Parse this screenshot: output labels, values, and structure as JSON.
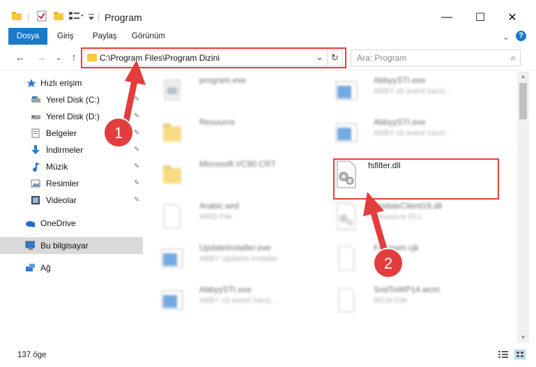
{
  "window": {
    "title": "Program",
    "minimize": "—",
    "maximize": "☐",
    "close": "✕"
  },
  "ribbon": {
    "tabs": [
      "Dosya",
      "Giriş",
      "Paylaş",
      "Görünüm"
    ],
    "expand": "⌄",
    "help": "?"
  },
  "address": {
    "path": "C:\\Program Files\\Program Dizini",
    "dropdown": "⌄",
    "refresh": "↻"
  },
  "nav": {
    "back": "←",
    "forward": "→",
    "recent": "⌄",
    "up": "↑"
  },
  "search": {
    "placeholder": "Ara: Program",
    "icon": "⌕"
  },
  "sidebar": {
    "items": [
      {
        "label": "Hızlı erişim",
        "icon": "star-icon",
        "pinned": false
      },
      {
        "label": "Yerel Disk (C:)",
        "icon": "drive-icon",
        "pinned": true
      },
      {
        "label": "Yerel Disk (D:)",
        "icon": "drive-icon",
        "pinned": true
      },
      {
        "label": "Belgeler",
        "icon": "document-icon",
        "pinned": true
      },
      {
        "label": "İndirmeler",
        "icon": "download-icon",
        "pinned": true
      },
      {
        "label": "Müzik",
        "icon": "music-icon",
        "pinned": true
      },
      {
        "label": "Resimler",
        "icon": "pictures-icon",
        "pinned": true
      },
      {
        "label": "Videolar",
        "icon": "video-icon",
        "pinned": true
      },
      {
        "label": "OneDrive",
        "icon": "cloud-icon",
        "pinned": false
      },
      {
        "label": "Bu bilgisayar",
        "icon": "computer-icon",
        "pinned": false,
        "selected": true
      },
      {
        "label": "Ağ",
        "icon": "network-icon",
        "pinned": false
      }
    ],
    "pin_glyph": "📌"
  },
  "files": [
    {
      "name": "program.exe",
      "desc": "",
      "icon": "exe-icon",
      "blurred": true
    },
    {
      "name": "AbbyySTI.exe",
      "desc": "ABBY cb event hand...",
      "icon": "app-window-icon",
      "blurred": true
    },
    {
      "name": "Resource",
      "desc": "",
      "icon": "folder-icon",
      "blurred": true
    },
    {
      "name": "AbbyySTI.exe",
      "desc": "ABBY cb event hand...",
      "icon": "app-window-icon",
      "blurred": true
    },
    {
      "name": "Microsoft.VC90.CRT",
      "desc": "",
      "icon": "folder-icon",
      "blurred": true
    },
    {
      "name": "fsfilter.dll",
      "desc": "",
      "icon": "dll-gears-icon",
      "blurred": false
    },
    {
      "name": "Arabic.wrd",
      "desc": "WRD File",
      "icon": "blank-file-icon",
      "blurred": true
    },
    {
      "name": "UpdateClient19.dll",
      "desc": "Resource DLL",
      "icon": "dll-gears-icon",
      "blurred": true
    },
    {
      "name": "UpdateInstaller.exe",
      "desc": "ABBY updates installer",
      "icon": "app-window-icon",
      "blurred": true
    },
    {
      "name": "FaFasim.cjk",
      "desc": "CJK File",
      "icon": "blank-file-icon",
      "blurred": true
    },
    {
      "name": "AbbyySTI.exe",
      "desc": "ABBY cb event hand...",
      "icon": "app-window-icon",
      "blurred": true
    },
    {
      "name": "SndToWP14.wcm",
      "desc": "WCM File",
      "icon": "blank-file-icon",
      "blurred": true
    }
  ],
  "status": {
    "count": "137 öge"
  },
  "annotations": [
    {
      "number": "1",
      "color": "#e43d3d"
    },
    {
      "number": "2",
      "color": "#e43d3d"
    }
  ],
  "colors": {
    "accent": "#1979ca",
    "highlight": "#e43d3d",
    "folder": "#f5c842"
  }
}
